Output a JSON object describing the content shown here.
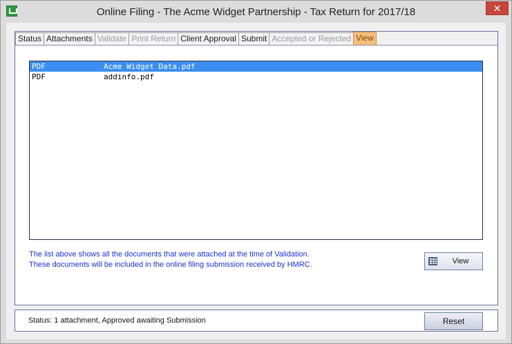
{
  "window": {
    "title": "Online Filing - The Acme Widget Partnership - Tax Return for 2017/18",
    "close_label": "✕"
  },
  "tabs": [
    {
      "label": "Status",
      "state": "enabled"
    },
    {
      "label": "Attachments",
      "state": "enabled"
    },
    {
      "label": "Validate",
      "state": "disabled"
    },
    {
      "label": "Print Return",
      "state": "disabled"
    },
    {
      "label": "Client Approval",
      "state": "enabled"
    },
    {
      "label": "Submit",
      "state": "enabled"
    },
    {
      "label": "Accepted or Rejected",
      "state": "disabled"
    },
    {
      "label": "View",
      "state": "active"
    }
  ],
  "files": [
    {
      "type": "PDF",
      "name": "Acme Widget Data.pdf",
      "selected": true
    },
    {
      "type": "PDF",
      "name": "addinfo.pdf",
      "selected": false
    }
  ],
  "info": {
    "line1": "The list above shows all the documents that were attached at the time of Validation.",
    "line2": "These documents will be included in the online filing submission received by HMRC."
  },
  "view_button": {
    "label": "View",
    "icon": "table-icon"
  },
  "status": {
    "text": "Status: 1 attachment, Approved awaiting Submission"
  },
  "reset_button": {
    "label": "Reset"
  },
  "colors": {
    "active_tab": "#f5c07a",
    "selection": "#3b8ef0",
    "info_text": "#1e2fcf",
    "close_button": "#c7453a"
  }
}
